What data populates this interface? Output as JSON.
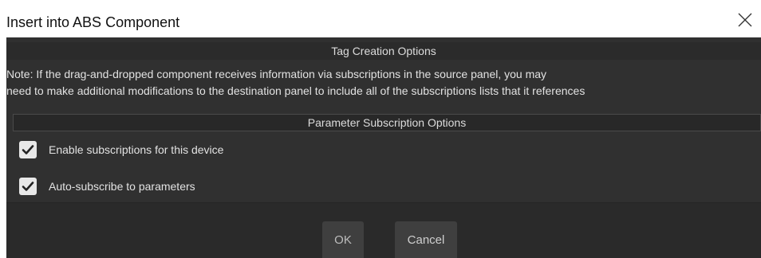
{
  "window": {
    "title": "Insert into ABS Component",
    "close_icon": "close-icon"
  },
  "tag_section": {
    "header": "Tag Creation Options",
    "note_lines": [
      "Note: If the drag-and-dropped component receives information via subscriptions in the source panel, you may",
      "need to make additional modifications to the destination panel to include all of the subscriptions lists that it references"
    ]
  },
  "param_section": {
    "header": "Parameter Subscription Options",
    "options": [
      {
        "label": "Enable subscriptions for this device",
        "checked": true,
        "icon": "checkmark-icon"
      },
      {
        "label": "Auto-subscribe to parameters",
        "checked": true,
        "icon": "checkmark-icon"
      }
    ]
  },
  "buttons": {
    "ok": "OK",
    "cancel": "Cancel"
  },
  "colors": {
    "dialog_background": "#303030",
    "header_background": "#2b2b2b",
    "text": "#e2e2e2",
    "checkbox": "#e8e8e8",
    "checkmark": "#222222"
  }
}
